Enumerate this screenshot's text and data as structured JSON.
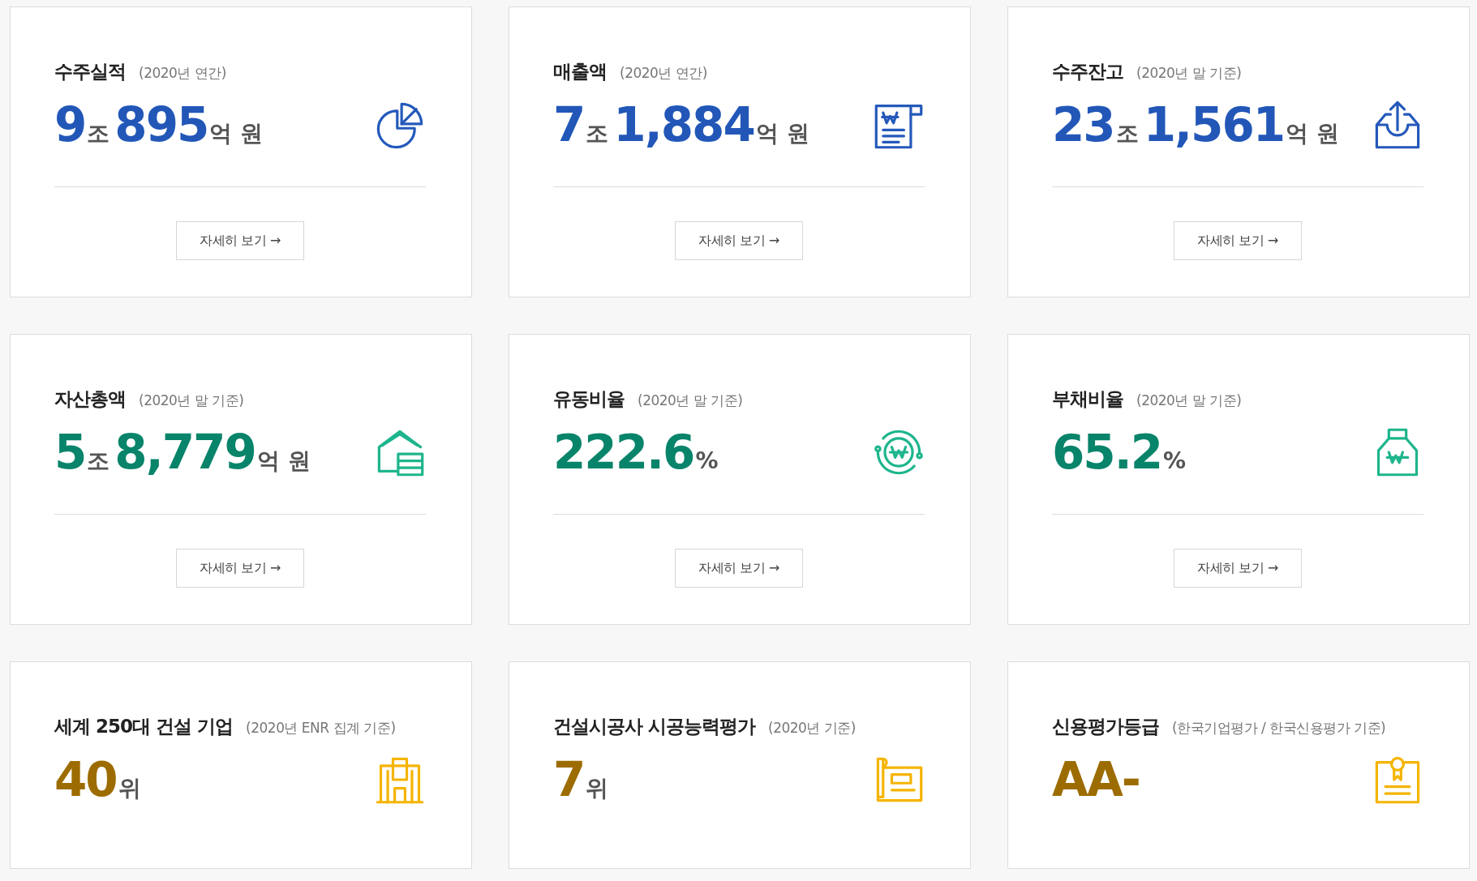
{
  "cards": [
    {
      "title": "수주실적",
      "subtitle": "(2020년 연간)",
      "value": [
        {
          "text": "9",
          "kind": "number"
        },
        {
          "text": "조",
          "kind": "unit"
        },
        {
          "text": "895",
          "kind": "number"
        },
        {
          "text": "억 원",
          "kind": "unit"
        }
      ],
      "button": "자세히 보기 →"
    },
    {
      "title": "매출액",
      "subtitle": "(2020년 연간)",
      "value": [
        {
          "text": "7",
          "kind": "number"
        },
        {
          "text": "조",
          "kind": "unit"
        },
        {
          "text": "1,884",
          "kind": "number"
        },
        {
          "text": "억 원",
          "kind": "unit"
        }
      ],
      "button": "자세히 보기 →"
    },
    {
      "title": "수주잔고",
      "subtitle": "(2020년 말 기준)",
      "value": [
        {
          "text": "23",
          "kind": "number"
        },
        {
          "text": "조",
          "kind": "unit"
        },
        {
          "text": "1,561",
          "kind": "number"
        },
        {
          "text": "억 원",
          "kind": "unit"
        }
      ],
      "button": "자세히 보기 →"
    },
    {
      "title": "자산총액",
      "subtitle": "(2020년 말 기준)",
      "value": [
        {
          "text": "5",
          "kind": "number"
        },
        {
          "text": "조",
          "kind": "unit"
        },
        {
          "text": "8,779",
          "kind": "number"
        },
        {
          "text": "억 원",
          "kind": "unit"
        }
      ],
      "button": "자세히 보기 →"
    },
    {
      "title": "유동비율",
      "subtitle": "(2020년 말 기준)",
      "value": [
        {
          "text": "222.6",
          "kind": "number"
        },
        {
          "text": "%",
          "kind": "unit"
        }
      ],
      "button": "자세히 보기 →"
    },
    {
      "title": "부채비율",
      "subtitle": "(2020년 말 기준)",
      "value": [
        {
          "text": "65.2",
          "kind": "number"
        },
        {
          "text": "%",
          "kind": "unit"
        }
      ],
      "button": "자세히 보기 →"
    },
    {
      "title": "세계 250대 건설 기업",
      "subtitle": "(2020년 ENR 집계 기준)",
      "value": [
        {
          "text": "40",
          "kind": "number"
        },
        {
          "text": "위",
          "kind": "unit"
        }
      ]
    },
    {
      "title": "건설시공사 시공능력평가",
      "subtitle": "(2020년 기준)",
      "value": [
        {
          "text": "7",
          "kind": "number"
        },
        {
          "text": "위",
          "kind": "unit"
        }
      ]
    },
    {
      "title": "신용평가등급",
      "subtitle": "(한국기업평가 / 한국신용평가 기준)",
      "value": [
        {
          "text": "AA-",
          "kind": "number"
        }
      ]
    }
  ]
}
